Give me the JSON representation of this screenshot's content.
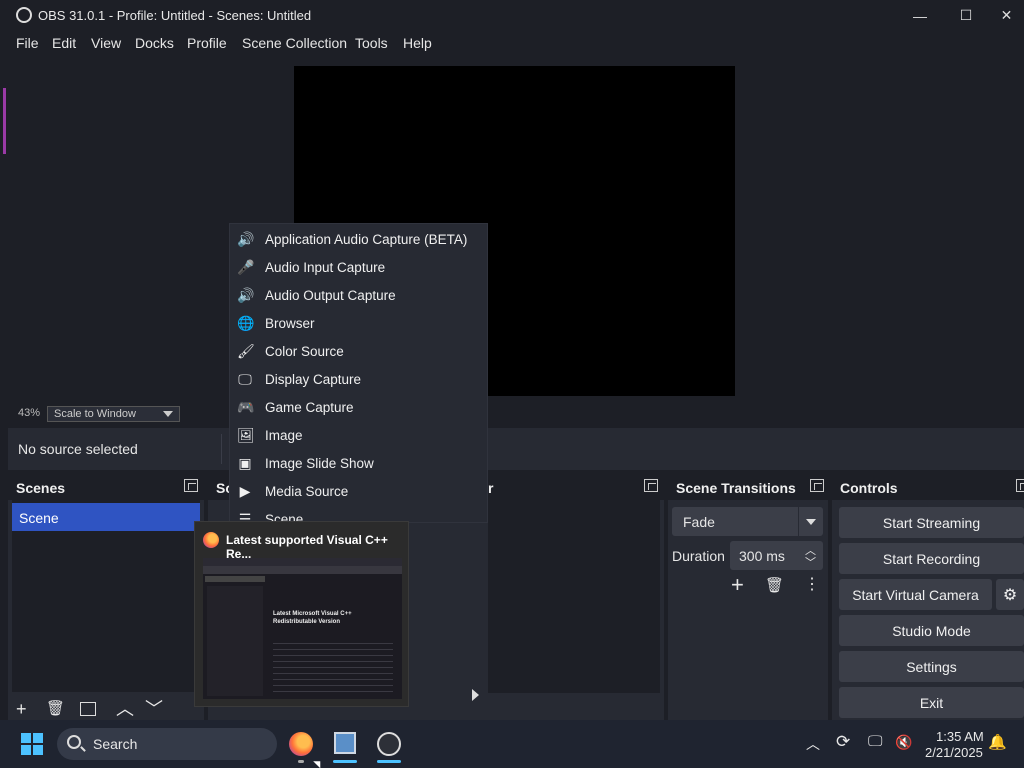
{
  "window": {
    "title": "OBS 31.0.1 - Profile: Untitled - Scenes: Untitled",
    "minimize": "—",
    "maximize": "☐",
    "close": "✕"
  },
  "menu": [
    "File",
    "Edit",
    "View",
    "Docks",
    "Profile",
    "Scene Collection",
    "Tools",
    "Help"
  ],
  "preview": {
    "zoom": "43%",
    "scale_mode": "Scale to Window"
  },
  "source_bar": {
    "status": "No source selected"
  },
  "scenes": {
    "title": "Scenes",
    "items": [
      "Scene"
    ]
  },
  "sources": {
    "title_partial": "So"
  },
  "mixer": {
    "title_partial": "r"
  },
  "transitions": {
    "title": "Scene Transitions",
    "selected": "Fade",
    "duration_label": "Duration",
    "duration_value": "300 ms"
  },
  "controls": {
    "title": "Controls",
    "buttons": [
      "Start Streaming",
      "Start Recording",
      "Start Virtual Camera",
      "Studio Mode",
      "Settings",
      "Exit"
    ]
  },
  "add_source_menu": {
    "items": [
      {
        "label": "Application Audio Capture (BETA)",
        "icon": "app-audio-icon"
      },
      {
        "label": "Audio Input Capture",
        "icon": "microphone-icon"
      },
      {
        "label": "Audio Output Capture",
        "icon": "speaker-icon"
      },
      {
        "label": "Browser",
        "icon": "globe-icon"
      },
      {
        "label": "Color Source",
        "icon": "brush-icon"
      },
      {
        "label": "Display Capture",
        "icon": "monitor-icon"
      },
      {
        "label": "Game Capture",
        "icon": "gamepad-icon"
      },
      {
        "label": "Image",
        "icon": "image-icon"
      },
      {
        "label": "Image Slide Show",
        "icon": "slideshow-icon"
      },
      {
        "label": "Media Source",
        "icon": "play-icon"
      },
      {
        "label": "Scene",
        "icon": "list-icon"
      }
    ]
  },
  "taskbar_preview": {
    "title": "Latest supported Visual C++ Re...",
    "page_heading": "Latest Microsoft Visual C++ Redistributable Version"
  },
  "taskbar": {
    "search_label": "Search",
    "time": "1:35 AM",
    "date": "2/21/2025"
  }
}
